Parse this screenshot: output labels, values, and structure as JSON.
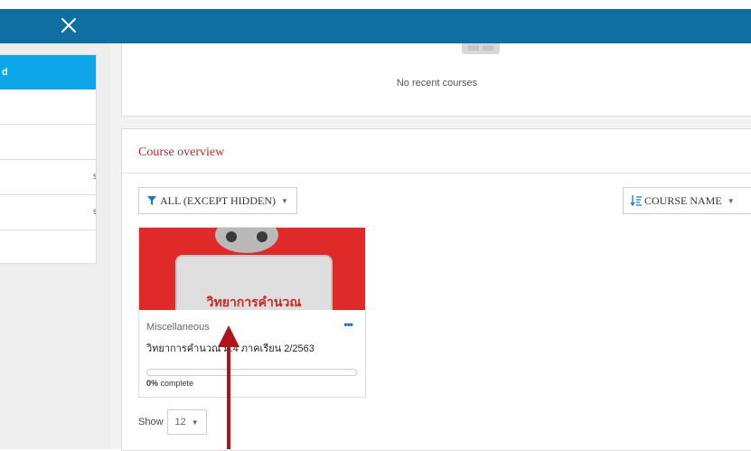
{
  "topbar": {
    "close_icon": "close-icon"
  },
  "sidebar": {
    "items": [
      {
        "label": "d"
      },
      {
        "label": ""
      },
      {
        "label": ""
      },
      {
        "label": "s"
      },
      {
        "label": "s"
      },
      {
        "label": ""
      }
    ]
  },
  "recent": {
    "empty_text": "No recent courses",
    "icon": "courses-illustration-icon"
  },
  "overview": {
    "title": "Course overview",
    "filter_label": "ALL (EXCEPT HIDDEN)",
    "sort_label": "COURSE NAME",
    "course": {
      "category": "Miscellaneous",
      "name": "วิทยาการคำนวณ ม.4 ภาคเรียน 2/2563",
      "image_text": "วิทยาการคำนวณ",
      "progress_percent": 0,
      "progress_value": "0%",
      "progress_suffix": " complete"
    },
    "show_label": "Show",
    "show_value": "12"
  },
  "colors": {
    "topbar": "#0f6fa3",
    "accent": "#0ea5e9",
    "title_red": "#b0302a",
    "card_image": "#e02a2a"
  }
}
